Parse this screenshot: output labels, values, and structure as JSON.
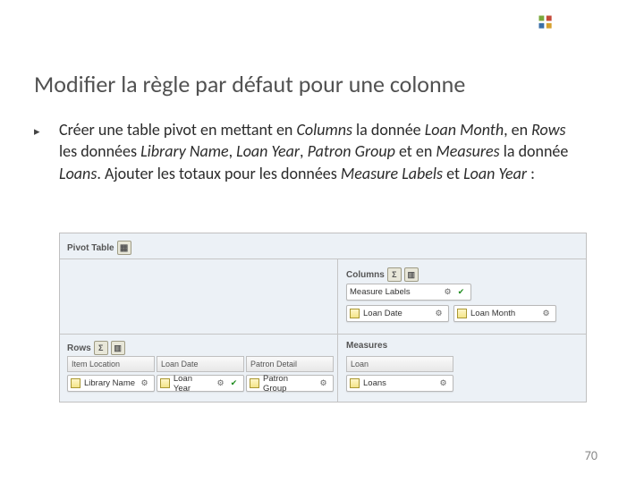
{
  "logo_name": "product-logo",
  "title": "Modifier la règle par défaut pour une colonne",
  "bullet_glyph": "▸",
  "body": {
    "p1": "Créer une table pivot en mettant en ",
    "em1": "Columns",
    "p2": " la donnée ",
    "em2": "Loan Month",
    "p3": ", en ",
    "em3": "Rows",
    "p4": " les données ",
    "em4": "Library Name",
    "p5": ", ",
    "em5": "Loan Year",
    "p6": ", ",
    "em6": "Patron Group",
    "p7": " et en ",
    "em7": "Measures",
    "p8": " la donnée ",
    "em8": "Loans",
    "p9": ". Ajouter les totaux pour les données ",
    "em9": "Measure Labels",
    "p10": " et ",
    "em10": "Loan Year",
    "p11": " :"
  },
  "figure": {
    "panel_title": "Pivot Table",
    "sections": {
      "columns": "Columns",
      "rows": "Rows",
      "measures": "Measures"
    },
    "columns_pills": [
      {
        "label": "Measure Labels",
        "total": true
      },
      {
        "label": "Loan Date",
        "suffix": "Loan Month",
        "total": false
      }
    ],
    "rows_headers": [
      "Item Location",
      "Loan Date",
      "Patron Detail"
    ],
    "rows_pills": [
      {
        "label": "Library Name",
        "total": false
      },
      {
        "label": "Loan Year",
        "total": true
      },
      {
        "label": "Patron Group",
        "total": false
      }
    ],
    "measures_headers": [
      "Loan"
    ],
    "measures_pills": [
      {
        "label": "Loans"
      }
    ],
    "icons": {
      "sigma": "Σ",
      "table": "▦",
      "chart": "▥",
      "gear": "⚙",
      "check": "✔"
    }
  },
  "page_number": "70"
}
